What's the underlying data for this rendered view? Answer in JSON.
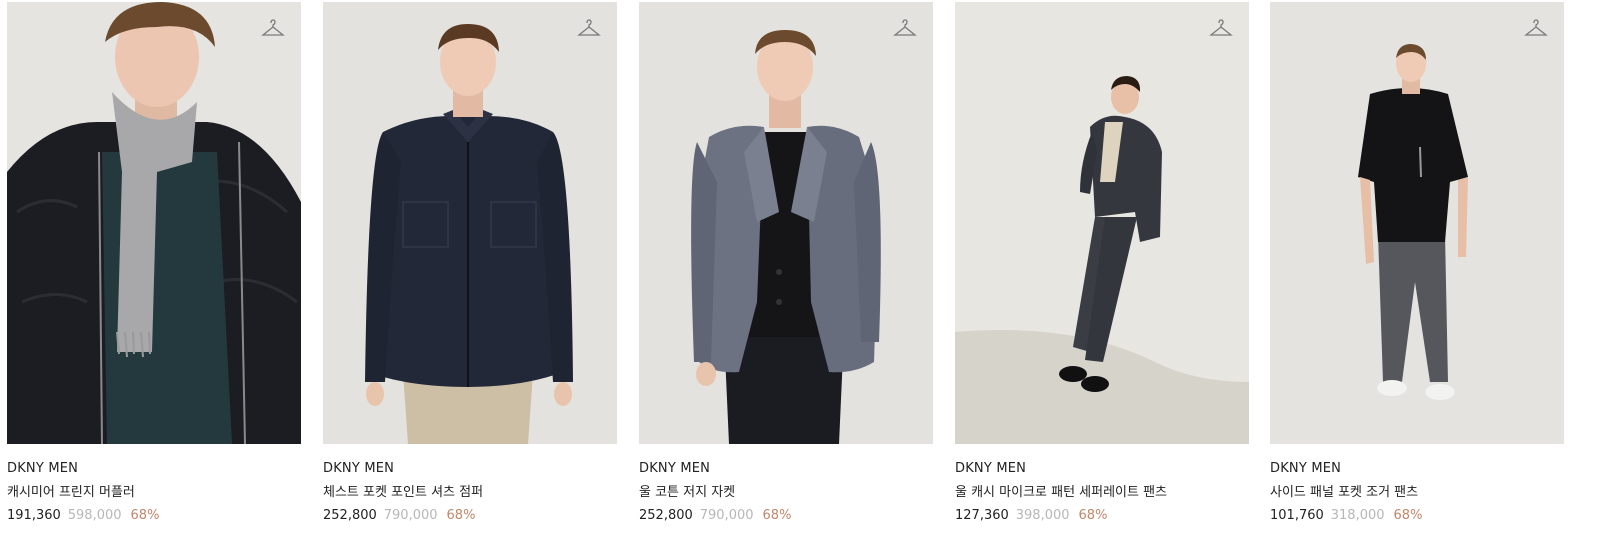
{
  "colors": {
    "discount": "#c0876a",
    "original_price": "#b7b7b7",
    "text": "#222222"
  },
  "products": [
    {
      "brand": "DKNY MEN",
      "name": "캐시미어 프린지 머플러",
      "price": "191,360",
      "original_price": "598,000",
      "discount": "68%",
      "icon": "hanger-icon"
    },
    {
      "brand": "DKNY MEN",
      "name": "체스트 포켓 포인트 셔츠 점퍼",
      "price": "252,800",
      "original_price": "790,000",
      "discount": "68%",
      "icon": "hanger-icon"
    },
    {
      "brand": "DKNY MEN",
      "name": "울 코튼 저지 자켓",
      "price": "252,800",
      "original_price": "790,000",
      "discount": "68%",
      "icon": "hanger-icon"
    },
    {
      "brand": "DKNY MEN",
      "name": "울 캐시 마이크로 패턴 세퍼레이트 팬츠",
      "price": "127,360",
      "original_price": "398,000",
      "discount": "68%",
      "icon": "hanger-icon"
    },
    {
      "brand": "DKNY MEN",
      "name": "사이드 패널 포켓 조거 팬츠",
      "price": "101,760",
      "original_price": "318,000",
      "discount": "68%",
      "icon": "hanger-icon"
    }
  ]
}
